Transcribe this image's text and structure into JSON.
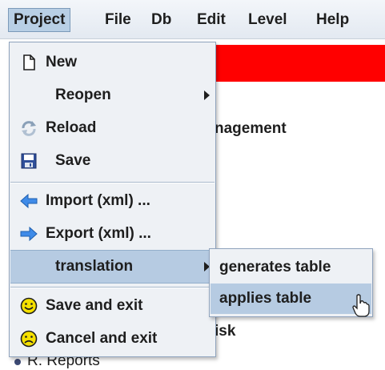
{
  "menubar": {
    "items": [
      {
        "label": "Project"
      },
      {
        "label": "File"
      },
      {
        "label": "Db"
      },
      {
        "label": "Edit"
      },
      {
        "label": "Level"
      },
      {
        "label": "Help"
      }
    ]
  },
  "background": {
    "text_management": "nagement",
    "text_isk": "isk",
    "text_reports": "R. Reports"
  },
  "project_menu": {
    "items": [
      {
        "label": "New",
        "icon": "document-icon"
      },
      {
        "label": "Reopen",
        "icon": ""
      },
      {
        "label": "Reload",
        "icon": "reload-icon"
      },
      {
        "label": "Save",
        "icon": "floppy-disk-icon"
      },
      {
        "label": "Import (xml) ...",
        "icon": "arrow-left-icon"
      },
      {
        "label": "Export (xml) ...",
        "icon": "arrow-right-icon"
      },
      {
        "label": "translation",
        "icon": ""
      },
      {
        "label": "Save and exit",
        "icon": "happy-face-icon"
      },
      {
        "label": "Cancel and exit",
        "icon": "sad-face-icon"
      }
    ]
  },
  "translation_submenu": {
    "items": [
      {
        "label": "generates table"
      },
      {
        "label": "applies table"
      }
    ]
  },
  "colors": {
    "selection": "#b6cbe2",
    "red_bar": "#ff0000",
    "menu_bg": "#eef1f5"
  }
}
